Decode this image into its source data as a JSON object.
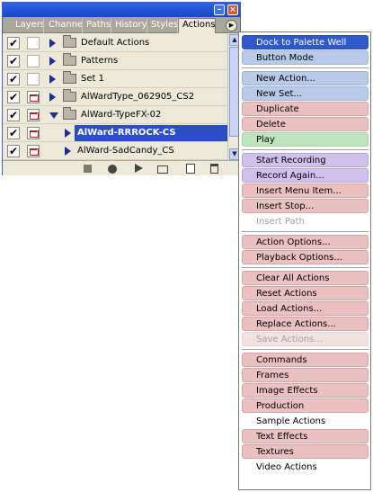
{
  "palette": {
    "titlebar": {
      "minimize_glyph": "–",
      "close_glyph": "×"
    },
    "tabs": [
      {
        "label": "Layers",
        "active": false
      },
      {
        "label": "Channe",
        "active": false
      },
      {
        "label": "Paths",
        "active": false
      },
      {
        "label": "History",
        "active": false
      },
      {
        "label": "Styles",
        "active": false
      },
      {
        "label": "Actions",
        "active": true
      }
    ],
    "menu_button_glyph": "▶",
    "rows": [
      {
        "label": "Default Actions",
        "checked": true,
        "dialog": false,
        "type": "set",
        "expanded": false
      },
      {
        "label": "Patterns",
        "checked": true,
        "dialog": false,
        "type": "set",
        "expanded": false
      },
      {
        "label": "Set 1",
        "checked": true,
        "dialog": false,
        "type": "set",
        "expanded": false
      },
      {
        "label": "AlWardType_062905_CS2",
        "checked": true,
        "dialog": true,
        "type": "set",
        "expanded": false
      },
      {
        "label": "AlWard-TypeFX-02",
        "checked": true,
        "dialog": true,
        "type": "set",
        "expanded": true
      },
      {
        "label": "AlWard-RRROCK-CS",
        "checked": true,
        "dialog": true,
        "type": "action",
        "selected": true
      },
      {
        "label": "AlWard-SadCandy_CS",
        "checked": true,
        "dialog": true,
        "type": "action",
        "selected": false
      }
    ],
    "check_glyph": "✔",
    "bottom_buttons": [
      "stop-icon",
      "record-icon",
      "play-icon",
      "new-set-folder-icon",
      "new-action-icon",
      "delete-trash-icon"
    ]
  },
  "menu": {
    "items": [
      {
        "label": "Dock to Palette Well",
        "color": "highlight",
        "enabled": true
      },
      {
        "label": "Button Mode",
        "color": "blue",
        "enabled": true
      },
      {
        "separator": true
      },
      {
        "label": "New Action...",
        "color": "blue",
        "enabled": true
      },
      {
        "label": "New Set...",
        "color": "blue",
        "enabled": true
      },
      {
        "label": "Duplicate",
        "color": "red",
        "enabled": true
      },
      {
        "label": "Delete",
        "color": "red",
        "enabled": true
      },
      {
        "label": "Play",
        "color": "green",
        "enabled": true
      },
      {
        "separator": true
      },
      {
        "label": "Start Recording",
        "color": "violet",
        "enabled": true
      },
      {
        "label": "Record Again...",
        "color": "violet",
        "enabled": true
      },
      {
        "label": "Insert Menu Item...",
        "color": "red",
        "enabled": true
      },
      {
        "label": "Insert Stop...",
        "color": "red",
        "enabled": true
      },
      {
        "label": "Insert Path",
        "color": "none",
        "enabled": false
      },
      {
        "separator": true
      },
      {
        "label": "Action Options...",
        "color": "red",
        "enabled": true
      },
      {
        "label": "Playback Options...",
        "color": "red",
        "enabled": true
      },
      {
        "separator": true
      },
      {
        "label": "Clear All Actions",
        "color": "red",
        "enabled": true
      },
      {
        "label": "Reset Actions",
        "color": "red",
        "enabled": true
      },
      {
        "label": "Load Actions...",
        "color": "red",
        "enabled": true
      },
      {
        "label": "Replace Actions...",
        "color": "red",
        "enabled": true
      },
      {
        "label": "Save Actions...",
        "color": "red",
        "enabled": false
      },
      {
        "separator": true
      },
      {
        "label": "Commands",
        "color": "red",
        "enabled": true
      },
      {
        "label": "Frames",
        "color": "red",
        "enabled": true
      },
      {
        "label": "Image Effects",
        "color": "red",
        "enabled": true
      },
      {
        "label": "Production",
        "color": "red",
        "enabled": true
      },
      {
        "label": "Sample Actions",
        "color": "none",
        "enabled": true
      },
      {
        "label": "Text Effects",
        "color": "red",
        "enabled": true
      },
      {
        "label": "Textures",
        "color": "red",
        "enabled": true
      },
      {
        "label": "Video Actions",
        "color": "none",
        "enabled": true
      }
    ]
  }
}
